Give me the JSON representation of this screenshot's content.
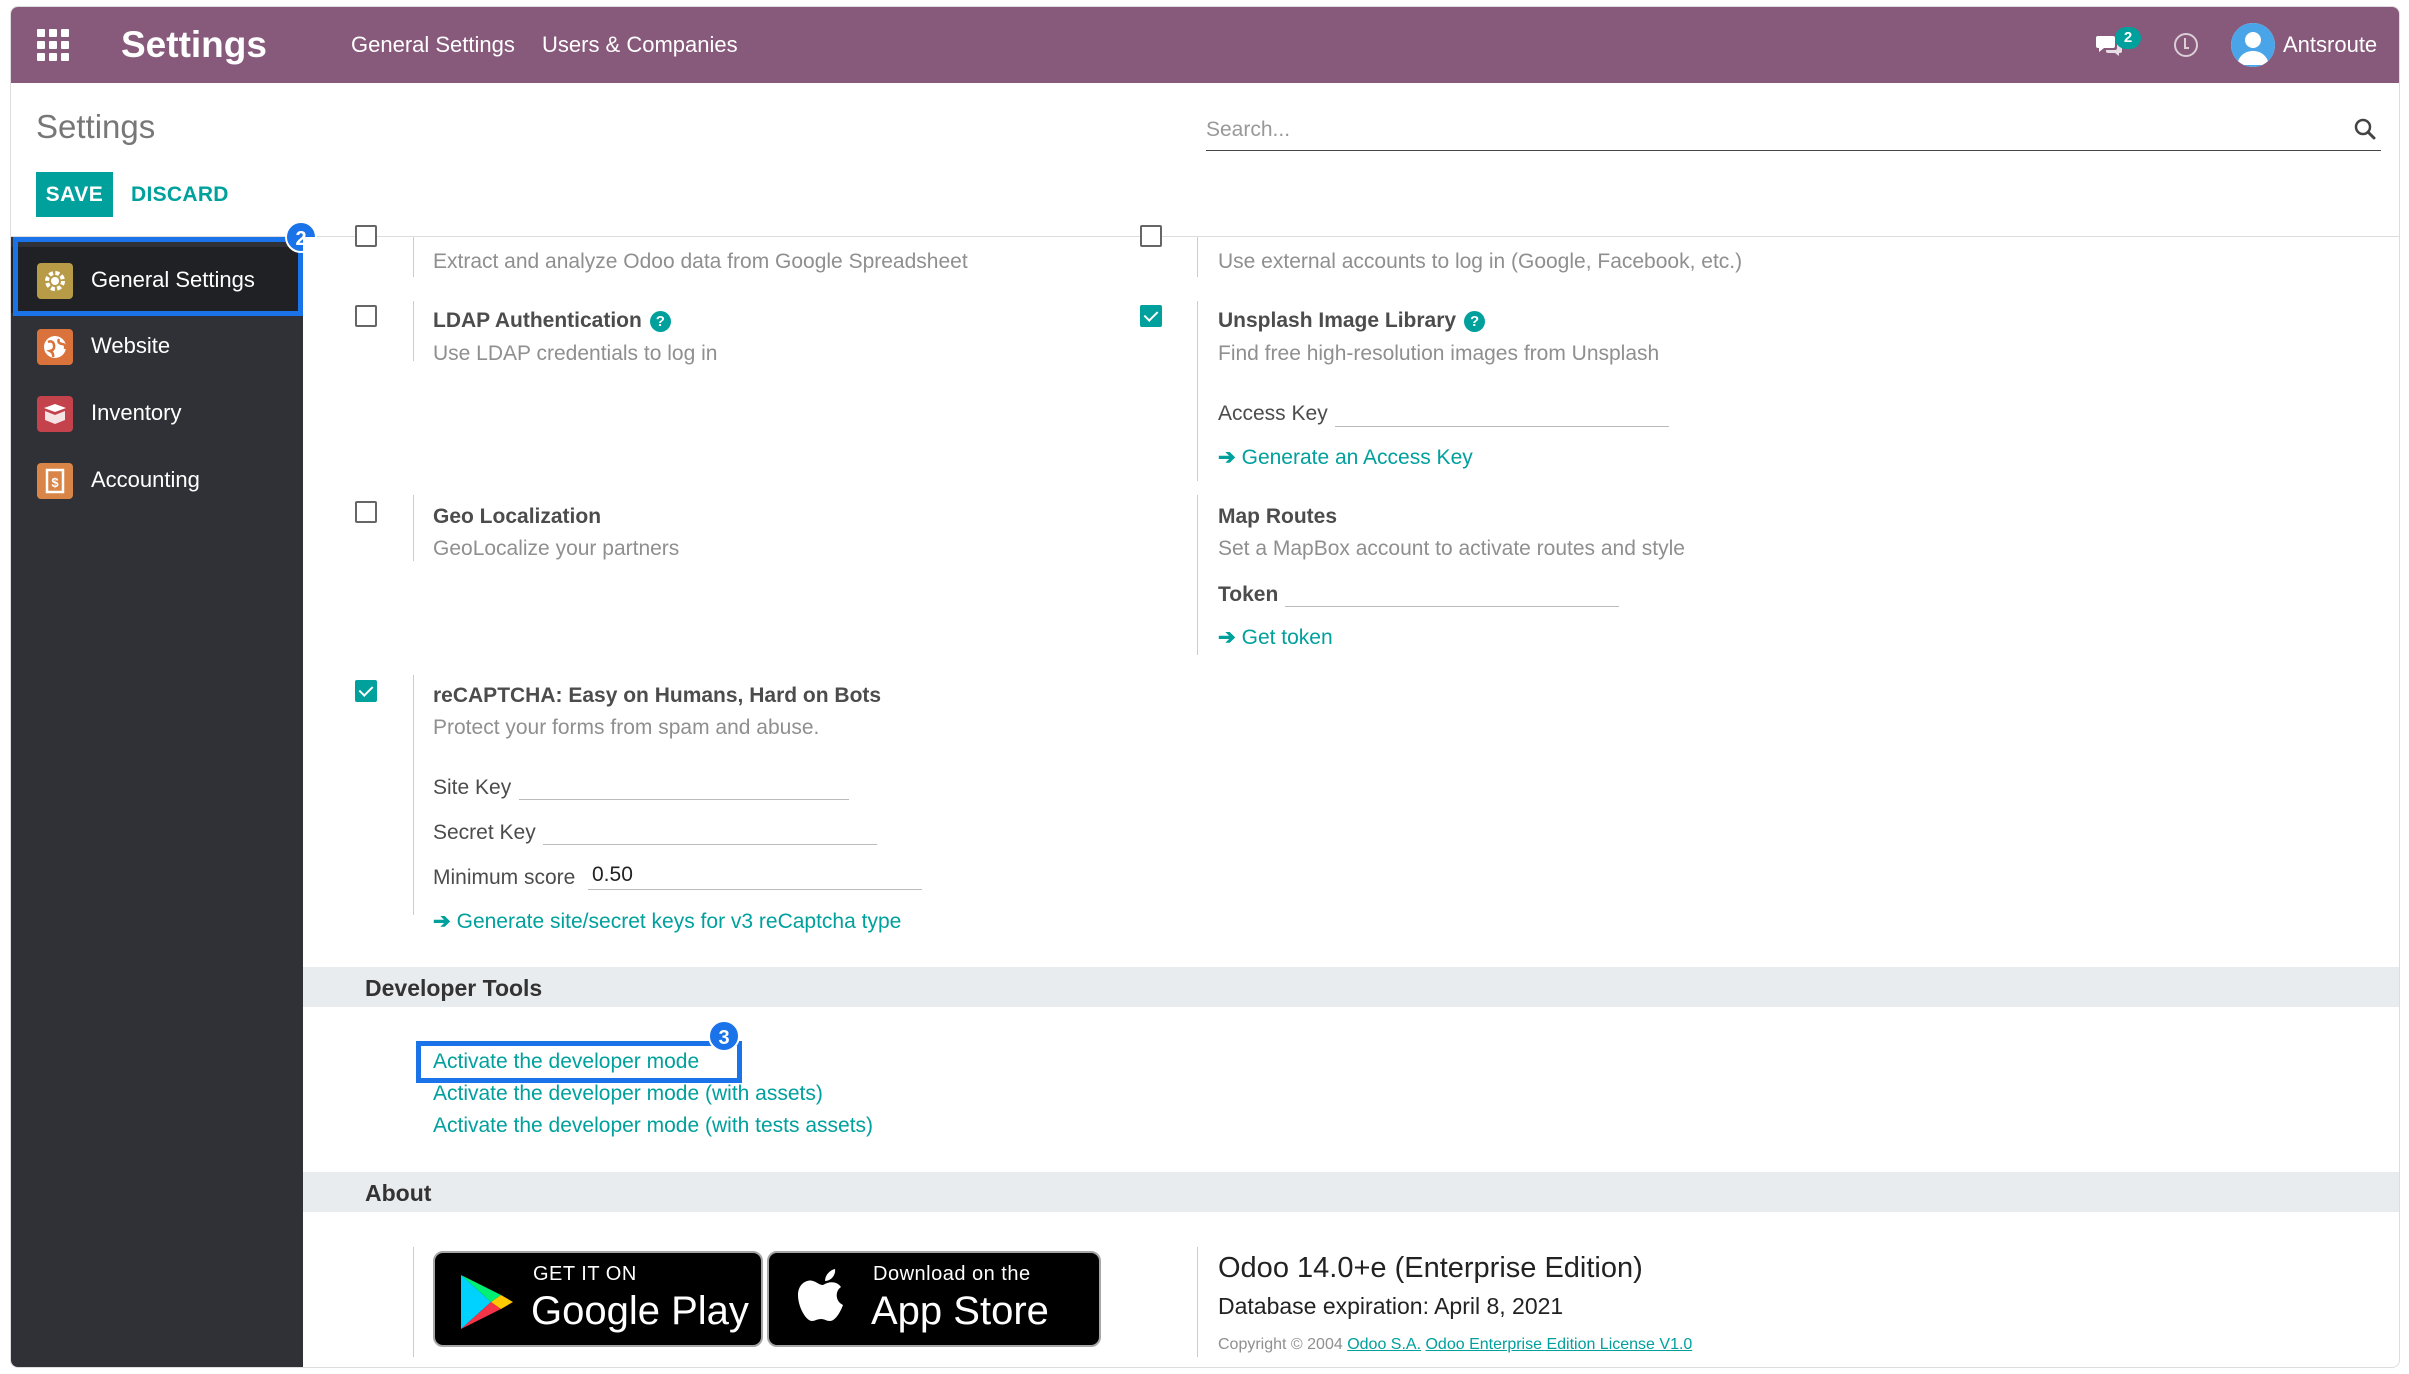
{
  "navbar": {
    "app_title": "Settings",
    "menus": [
      "General Settings",
      "Users & Companies"
    ],
    "chat_badge": "2",
    "user_name": "Antsroute"
  },
  "control_panel": {
    "title": "Settings",
    "search_placeholder": "Search...",
    "save_label": "SAVE",
    "discard_label": "DISCARD"
  },
  "sidebar": {
    "items": [
      {
        "label": "General Settings",
        "icon": "gear-icon",
        "color": "#b79b46"
      },
      {
        "label": "Website",
        "icon": "globe-icon",
        "color": "#d9733b"
      },
      {
        "label": "Inventory",
        "icon": "box-icon",
        "color": "#c4424c"
      },
      {
        "label": "Accounting",
        "icon": "invoice-icon",
        "color": "#d88547"
      }
    ]
  },
  "callouts": {
    "sidebar": "2",
    "developer": "3"
  },
  "settings": {
    "google_spreadsheet": {
      "desc": "Extract and analyze Odoo data from Google Spreadsheet"
    },
    "oauth": {
      "desc": "Use external accounts to log in (Google, Facebook, etc.)"
    },
    "ldap": {
      "title": "LDAP Authentication",
      "desc": "Use LDAP credentials to log in",
      "checked": false
    },
    "unsplash": {
      "title": "Unsplash Image Library",
      "desc": "Find free high-resolution images from Unsplash",
      "checked": true,
      "access_key_label": "Access Key",
      "access_key_value": "",
      "link": "Generate an Access Key"
    },
    "geo": {
      "title": "Geo Localization",
      "desc": "GeoLocalize your partners",
      "checked": false
    },
    "map_routes": {
      "title": "Map Routes",
      "desc": "Set a MapBox account to activate routes and style",
      "token_label": "Token",
      "token_value": "",
      "link": "Get token"
    },
    "recaptcha": {
      "title": "reCAPTCHA: Easy on Humans, Hard on Bots",
      "desc": "Protect your forms from spam and abuse.",
      "checked": true,
      "site_key_label": "Site Key",
      "site_key_value": "",
      "secret_key_label": "Secret Key",
      "secret_key_value": "",
      "min_score_label": "Minimum score",
      "min_score_value": "0.50",
      "link": "Generate site/secret keys for v3 reCaptcha type"
    }
  },
  "developer_tools": {
    "header": "Developer Tools",
    "links": [
      "Activate the developer mode",
      "Activate the developer mode (with assets)",
      "Activate the developer mode (with tests assets)"
    ]
  },
  "about": {
    "header": "About",
    "google_play": {
      "small": "GET IT ON",
      "big": "Google Play"
    },
    "app_store": {
      "small": "Download on the",
      "big": "App Store"
    },
    "version": "Odoo 14.0+e (Enterprise Edition)",
    "expiration": "Database expiration: April 8, 2021",
    "copyright": "Copyright © 2004",
    "company_link": "Odoo S.A.",
    "license_link": "Odoo Enterprise Edition License V1.0"
  },
  "colors": {
    "brand": "#875a7b",
    "accent": "#00a09d",
    "highlight": "#1a73e8"
  }
}
